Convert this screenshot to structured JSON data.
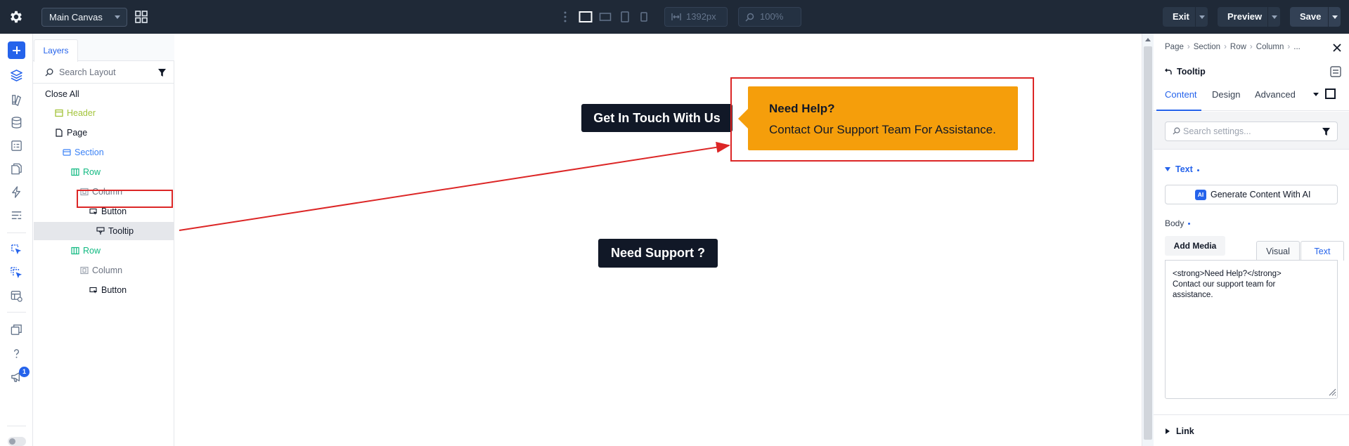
{
  "topbar": {
    "canvas_select": "Main Canvas",
    "width_value": "1392px",
    "zoom_value": "100%",
    "exit_label": "Exit",
    "preview_label": "Preview",
    "save_label": "Save"
  },
  "rail": {
    "icons": [
      "add-icon",
      "layers-icon",
      "theme-builder-icon",
      "database-icon",
      "form-icon",
      "pages-icon",
      "lightning-icon",
      "settings-list-icon",
      "cursor-pointer-icon",
      "cursor-multi-icon",
      "template-icon",
      "stack-icon",
      "help-icon",
      "megaphone-icon"
    ],
    "notification_count": "1"
  },
  "layers": {
    "tab_label": "Layers",
    "search_placeholder": "Search Layout",
    "close_all": "Close All",
    "items": [
      {
        "label": "Header",
        "type": "header"
      },
      {
        "label": "Page",
        "type": "page"
      },
      {
        "label": "Section",
        "type": "section"
      },
      {
        "label": "Row",
        "type": "row"
      },
      {
        "label": "Column",
        "type": "column"
      },
      {
        "label": "Button",
        "type": "module"
      },
      {
        "label": "Tooltip",
        "type": "module",
        "selected": true
      },
      {
        "label": "Row",
        "type": "row"
      },
      {
        "label": "Column",
        "type": "column"
      },
      {
        "label": "Button",
        "type": "module"
      }
    ]
  },
  "canvas": {
    "button_touch": "Get In Touch With Us",
    "tooltip_title": "Need Help?",
    "tooltip_body": "Contact Our Support Team For Assistance.",
    "button_support": "Need Support ?",
    "tooltip_color": "#f59e0b",
    "highlight_color": "#dc2626"
  },
  "settings": {
    "breadcrumb": [
      "Page",
      "Section",
      "Row",
      "Column",
      "..."
    ],
    "title": "Tooltip",
    "tabs": [
      "Content",
      "Design",
      "Advanced"
    ],
    "active_tab": "Content",
    "search_placeholder": "Search settings...",
    "group_label": "Text",
    "ai_button": "Generate Content With AI",
    "ai_badge": "AI",
    "body_label": "Body",
    "add_media": "Add Media",
    "editor_tabs": [
      "Visual",
      "Text"
    ],
    "editor_active_tab": "Text",
    "editor_content": "<strong>Need Help?</strong>\nContact our support team for\nassistance.",
    "link_label": "Link",
    "accent_color": "#2563eb"
  }
}
